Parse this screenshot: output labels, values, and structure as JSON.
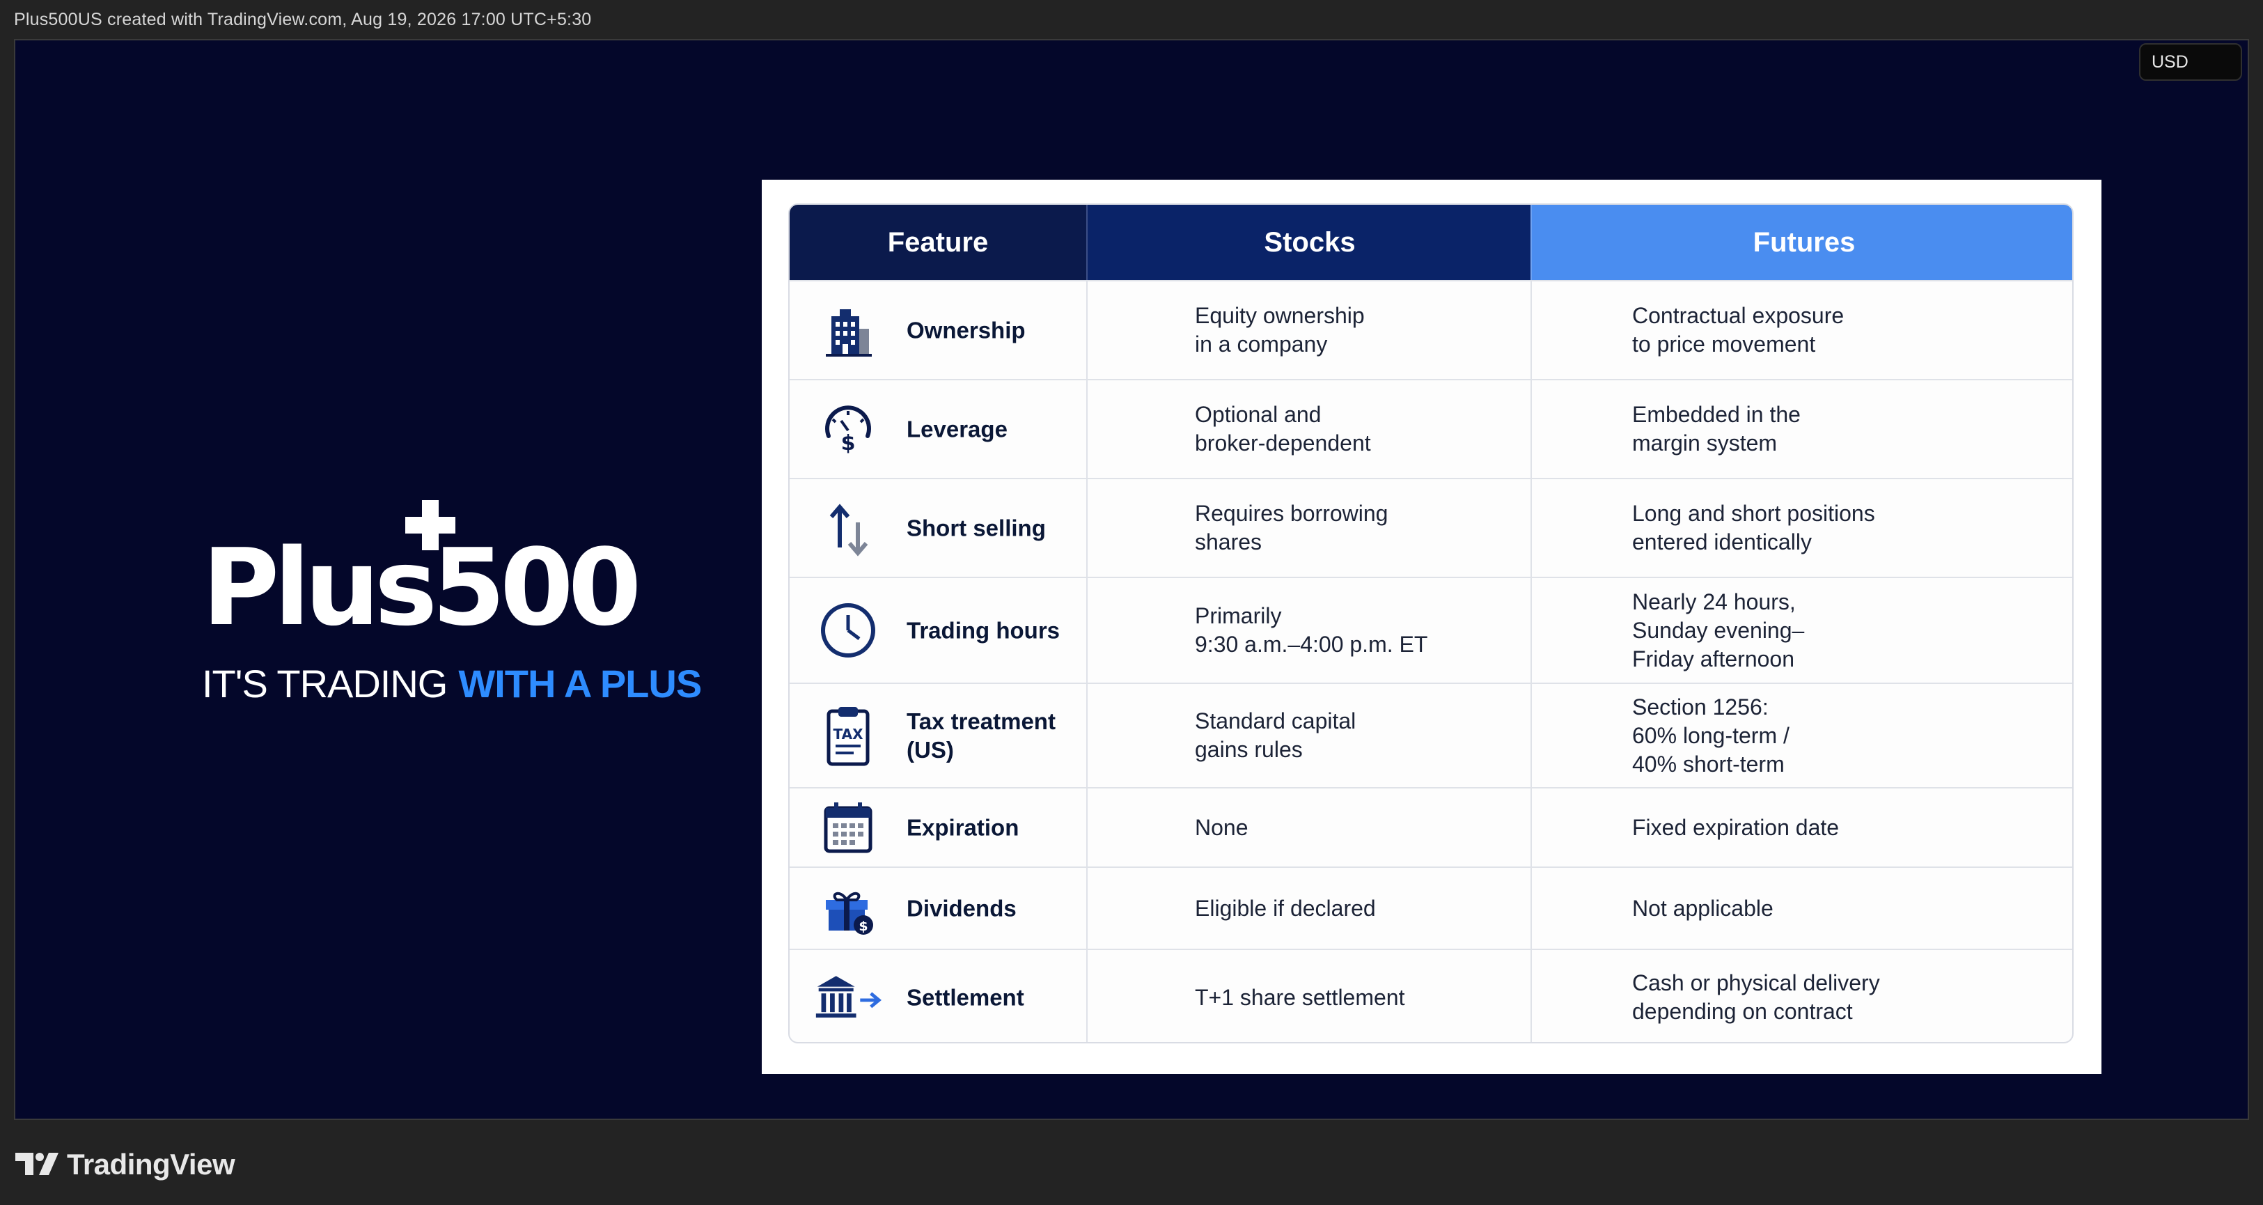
{
  "topbar": {
    "caption": "Plus500US created with TradingView.com, Aug 19, 2026 17:00 UTC+5:30"
  },
  "currency": {
    "label": "USD"
  },
  "logo": {
    "wordmark": "Plus500",
    "tagline_white": "IT'S TRADING",
    "tagline_blue": "WITH A PLUS"
  },
  "table": {
    "headers": {
      "feature": "Feature",
      "stocks": "Stocks",
      "futures": "Futures"
    },
    "rows": [
      {
        "icon": "building-icon",
        "feature": "Ownership",
        "stocks": "Equity ownership\nin a company",
        "futures": "Contractual exposure\nto price movement"
      },
      {
        "icon": "gauge-dollar-icon",
        "feature": "Leverage",
        "stocks": "Optional and\nbroker-dependent",
        "futures": "Embedded in the\nmargin system"
      },
      {
        "icon": "up-down-arrows-icon",
        "feature": "Short selling",
        "stocks": "Requires borrowing\nshares",
        "futures": "Long and short positions\nentered identically"
      },
      {
        "icon": "clock-icon",
        "feature": "Trading hours",
        "stocks": "Primarily\n9:30 a.m.–4:00 p.m. ET",
        "futures": "Nearly 24 hours,\nSunday evening–\nFriday afternoon"
      },
      {
        "icon": "tax-clipboard-icon",
        "feature": "Tax treatment\n(US)",
        "stocks": "Standard capital\ngains rules",
        "futures": "Section 1256:\n60% long-term /\n40% short-term"
      },
      {
        "icon": "calendar-icon",
        "feature": "Expiration",
        "stocks": "None",
        "futures": "Fixed expiration date"
      },
      {
        "icon": "gift-dollar-icon",
        "feature": "Dividends",
        "stocks": "Eligible if declared",
        "futures": "Not applicable"
      },
      {
        "icon": "bank-arrow-icon",
        "feature": "Settlement",
        "stocks": "T+1 share settlement",
        "futures": "Cash or physical delivery\ndepending on contract"
      }
    ]
  },
  "footer": {
    "brand": "TradingView"
  },
  "colors": {
    "navy_bg": "#04072a",
    "header_navy": "#0b1a4c",
    "header_blue": "#4a8df0",
    "tagline_blue": "#2e8cff"
  }
}
